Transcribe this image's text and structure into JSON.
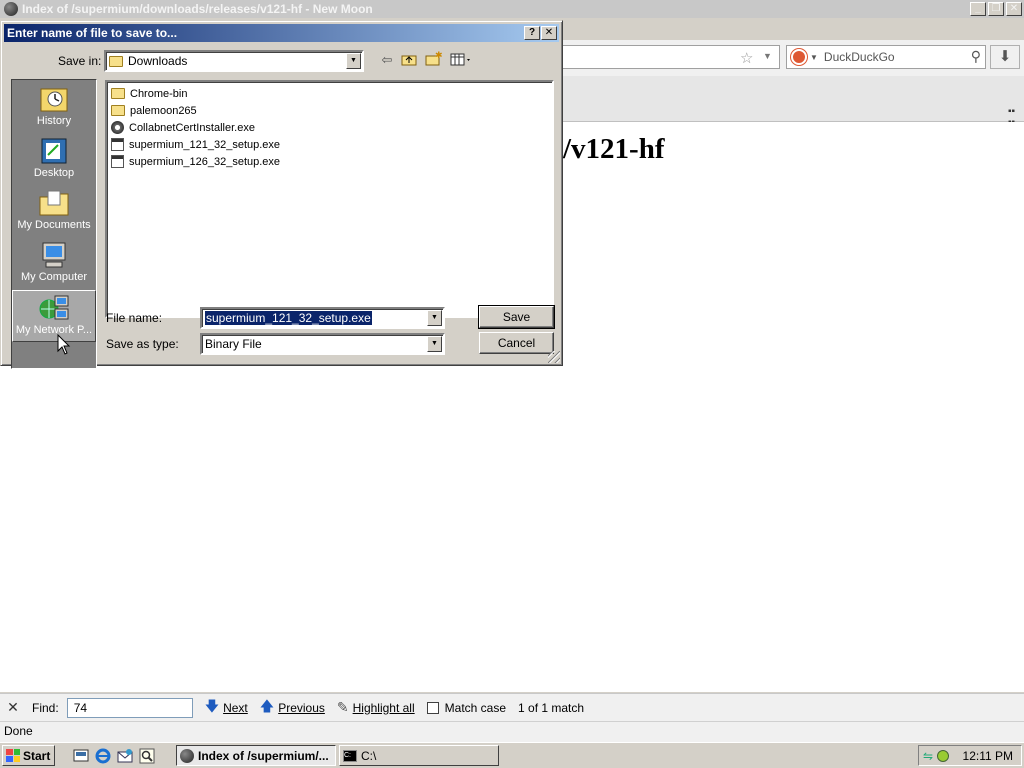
{
  "browser": {
    "title": "Index of /supermium/downloads/releases/v121-hf - New Moon",
    "search_placeholder": "DuckDuckGo",
    "page_heading": "/v121-hf"
  },
  "dialog": {
    "title": "Enter name of file to save to...",
    "save_in_label": "Save in:",
    "save_in_value": "Downloads",
    "places": [
      {
        "label": "History"
      },
      {
        "label": "Desktop"
      },
      {
        "label": "My Documents"
      },
      {
        "label": "My Computer"
      },
      {
        "label": "My Network P..."
      }
    ],
    "files": [
      {
        "name": "Chrome-bin",
        "type": "folder"
      },
      {
        "name": "palemoon265",
        "type": "folder"
      },
      {
        "name": "CollabnetCertInstaller.exe",
        "type": "installer"
      },
      {
        "name": "supermium_121_32_setup.exe",
        "type": "exe"
      },
      {
        "name": "supermium_126_32_setup.exe",
        "type": "exe"
      }
    ],
    "file_name_label": "File name:",
    "file_name_value": "supermium_121_32_setup.exe",
    "save_as_type_label": "Save as type:",
    "save_as_type_value": "Binary File",
    "save_button": "Save",
    "cancel_button": "Cancel"
  },
  "findbar": {
    "find_label": "Find:",
    "find_value": "74",
    "next_label": "Next",
    "previous_label": "Previous",
    "highlight_label": "Highlight all",
    "match_case_label": "Match case",
    "match_count": "1 of 1 match"
  },
  "statusbar": {
    "text": "Done"
  },
  "taskbar": {
    "start_label": "Start",
    "tasks": [
      {
        "label": "Index of /supermium/..."
      },
      {
        "label": "C:\\"
      }
    ],
    "clock": "12:11 PM"
  },
  "colors": {
    "dialog_title_start": "#0a246a",
    "dialog_title_end": "#a6caf0",
    "face": "#d4d0c8",
    "selection": "#0a246a"
  }
}
